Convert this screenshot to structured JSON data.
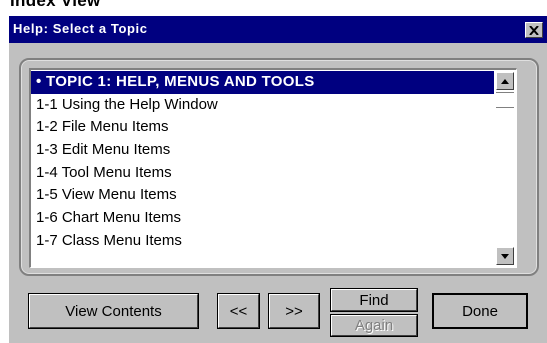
{
  "heading": "Index View",
  "window": {
    "title": "Help: Select a Topic",
    "close_glyph": "✕"
  },
  "topics": [
    {
      "label": "• TOPIC 1: HELP, MENUS AND TOOLS",
      "selected": true
    },
    {
      "label": "1-1 Using the Help Window",
      "selected": false
    },
    {
      "label": "1-2 File Menu Items",
      "selected": false
    },
    {
      "label": "1-3 Edit Menu Items",
      "selected": false
    },
    {
      "label": "1-4 Tool Menu Items",
      "selected": false
    },
    {
      "label": "1-5 View Menu Items",
      "selected": false
    },
    {
      "label": "1-6 Chart Menu Items",
      "selected": false
    },
    {
      "label": "1-7 Class Menu Items",
      "selected": false
    }
  ],
  "buttons": {
    "view_contents": "View Contents",
    "prev": "<<",
    "next": ">>",
    "find": "Find",
    "again": "Again",
    "done": "Done"
  },
  "colors": {
    "titlebar": "#000080",
    "face": "#c0c0c0",
    "selection": "#000080"
  }
}
